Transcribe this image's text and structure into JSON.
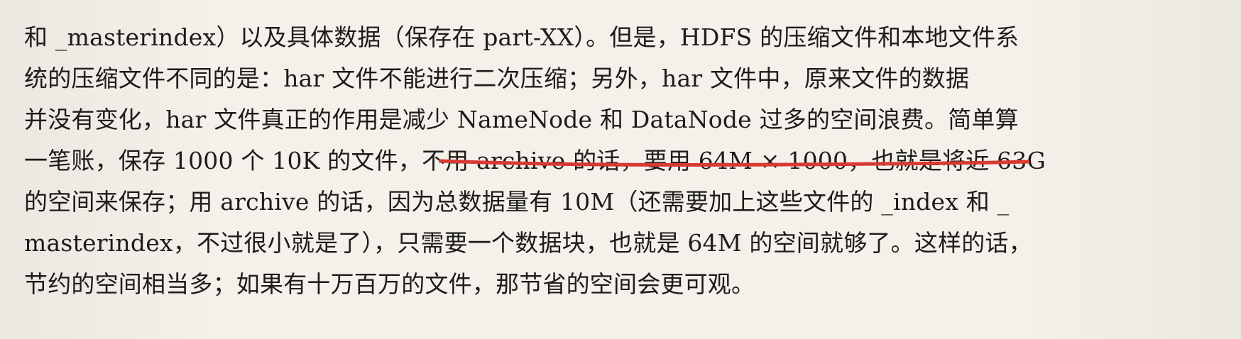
{
  "document": {
    "cut_line": "(part of the preceding line is cropped at the top of the page)",
    "lines": [
      "和 _masterindex）以及具体数据（保存在 part-XX）。但是，HDFS 的压缩文件和本地文件系",
      "统的压缩文件不同的是：har 文件不能进行二次压缩；另外，har 文件中，原来文件的数据",
      {
        "before": "并没有变化，har 文件真正的作",
        "underlined": "用是减少 NameNode 和 DataNode 过多的空间浪费",
        "after": "。简单算"
      },
      "一笔账，保存 1000 个 10K 的文件，不用 archive 的话，要用 64M × 1000，也就是将近 63G",
      "的空间来保存；用 archive 的话，因为总数据量有 10M（还需要加上这些文件的 _index 和 _",
      "masterindex，不过很小就是了），只需要一个数据块，也就是 64M 的空间就够了。这样的话，",
      "节约的空间相当多；如果有十万百万的文件，那节省的空间会更可观。"
    ]
  }
}
